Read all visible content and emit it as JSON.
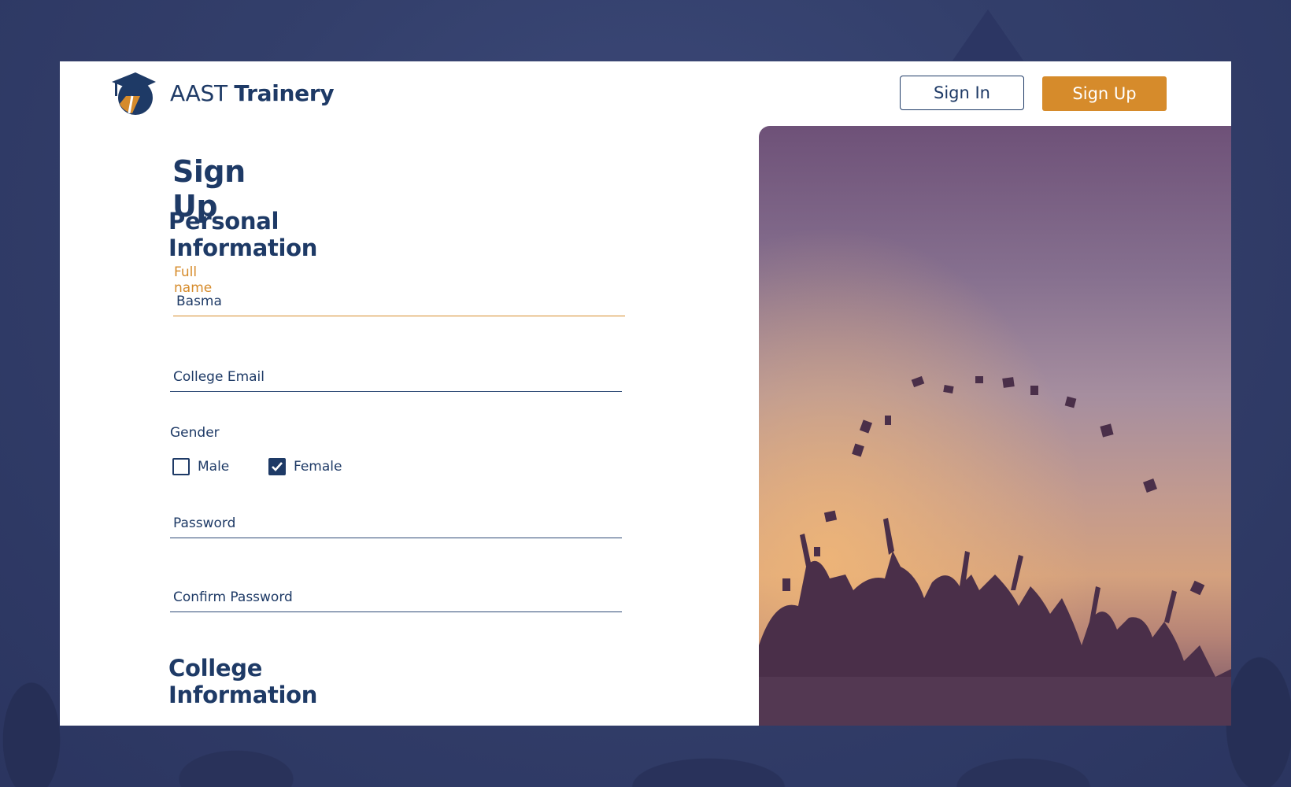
{
  "brand": {
    "name_light": "AAST",
    "name_bold": "Trainery",
    "colors": {
      "primary": "#1e3a66",
      "accent": "#d68b2b"
    }
  },
  "header": {
    "sign_in_label": "Sign In",
    "sign_up_label": "Sign Up"
  },
  "form": {
    "title": "Sign Up",
    "personal_section": "Personal Information",
    "full_name": {
      "label": "Full name",
      "value": "Basma"
    },
    "college_email": {
      "placeholder": "College Email",
      "value": ""
    },
    "gender": {
      "label": "Gender",
      "options": [
        {
          "label": "Male",
          "checked": false
        },
        {
          "label": "Female",
          "checked": true
        }
      ]
    },
    "password": {
      "placeholder": "Password"
    },
    "confirm_password": {
      "placeholder": "Confirm Password"
    },
    "college_section": "College Information"
  }
}
